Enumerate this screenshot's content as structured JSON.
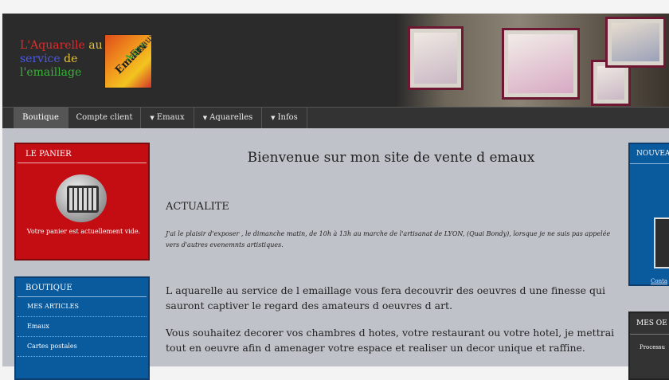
{
  "header": {
    "logo_line1_a": "L'Aquarelle",
    "logo_line1_b": " au",
    "logo_line2_a": "service",
    "logo_line2_b": " de",
    "logo_line3": "l'emaillage",
    "logo_badge_emaux": "Emaux",
    "logo_badge_aqua": "Aqua",
    "logo_badge_small": "Emaux"
  },
  "nav": {
    "items": [
      {
        "label": "Boutique"
      },
      {
        "label": "Compte client"
      },
      {
        "label": "Emaux"
      },
      {
        "label": "Aquarelles"
      },
      {
        "label": "Infos"
      }
    ],
    "dropdown_icon": "caret-down-icon"
  },
  "panier": {
    "title": "LE PANIER",
    "text": "Votre panier est actuellement vide.",
    "icon": "shopping-cart-icon"
  },
  "boutique": {
    "title": "BOUTIQUE",
    "items": [
      {
        "label": "MES ARTICLES"
      },
      {
        "label": "Emaux"
      },
      {
        "label": "Cartes postales"
      }
    ]
  },
  "main": {
    "title": "Bienvenue sur mon site de vente d emaux",
    "section": "ACTUALITE",
    "news": "J'ai le plaisir d'exposer , le dimanche matin, de 10h à 13h au marche de l'artisanat de LYON, (Quai Bondy), lorsque je ne suis pas appelée vers d'autres evenemnts artistiques.",
    "p1": "L aquarelle au service de l emaillage vous fera decouvrir des oeuvres d une finesse qui sauront captiver le regard des amateurs d oeuvres d art.",
    "p2": "Vous souhaitez decorer vos chambres d hotes, votre restaurant ou votre hotel, je mettrai tout en oeuvre afin d amenager votre espace et realiser un decor unique et raffine."
  },
  "right": {
    "nouveautes_title": "NOUVEA",
    "contact_link": "Conta",
    "oeuvres_title": "MES OE",
    "oeuvres_item": "Processu"
  },
  "colors": {
    "panier_bg": "#c40d13",
    "boutique_bg": "#0a5a9e",
    "nav_bg": "#333333",
    "page_bg": "#bfc2c8"
  }
}
